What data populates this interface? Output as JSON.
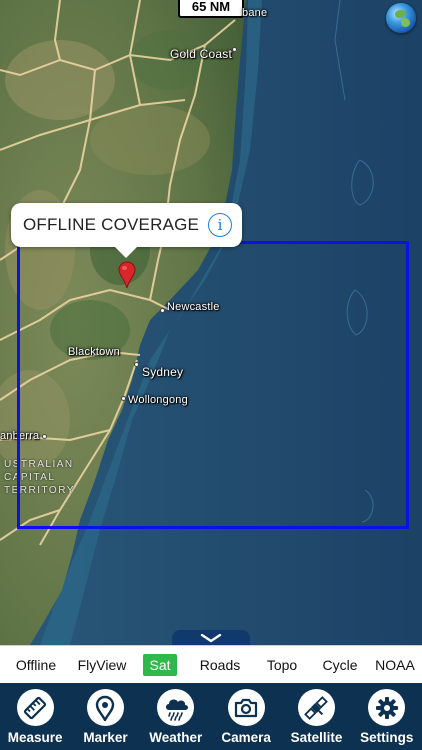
{
  "scale": {
    "label": "65 NM"
  },
  "map": {
    "labels": {
      "brisbane_partial": "bane",
      "gold_coast": "Gold Coast",
      "newcastle": "Newcastle",
      "blacktown": "Blacktown",
      "sydney": "Sydney",
      "wollongong": "Wollongong",
      "canberra_partial": "anberra",
      "territory": "USTRALIAN\nCAPITAL\nTERRITORY"
    },
    "coverage_color": "#0a12e6"
  },
  "callout": {
    "title": "OFFLINE COVERAGE",
    "info_symbol": "i"
  },
  "layers": [
    {
      "label": "Offline"
    },
    {
      "label": "FlyView"
    },
    {
      "label": "Sat"
    },
    {
      "label": "Roads"
    },
    {
      "label": "Topo"
    },
    {
      "label": "Cycle"
    },
    {
      "label": "NOAA"
    }
  ],
  "active_layer": "Sat",
  "toolbar": [
    {
      "label": "Measure",
      "icon": "ruler-icon"
    },
    {
      "label": "Marker",
      "icon": "map-pin-icon"
    },
    {
      "label": "Weather",
      "icon": "cloud-rain-icon"
    },
    {
      "label": "Camera",
      "icon": "camera-icon"
    },
    {
      "label": "Satellite",
      "icon": "satellite-icon"
    },
    {
      "label": "Settings",
      "icon": "gear-icon"
    }
  ],
  "colors": {
    "accent_green": "#2fb94a",
    "toolbar_bg": "#0d3150",
    "pin_red": "#d8262a"
  }
}
